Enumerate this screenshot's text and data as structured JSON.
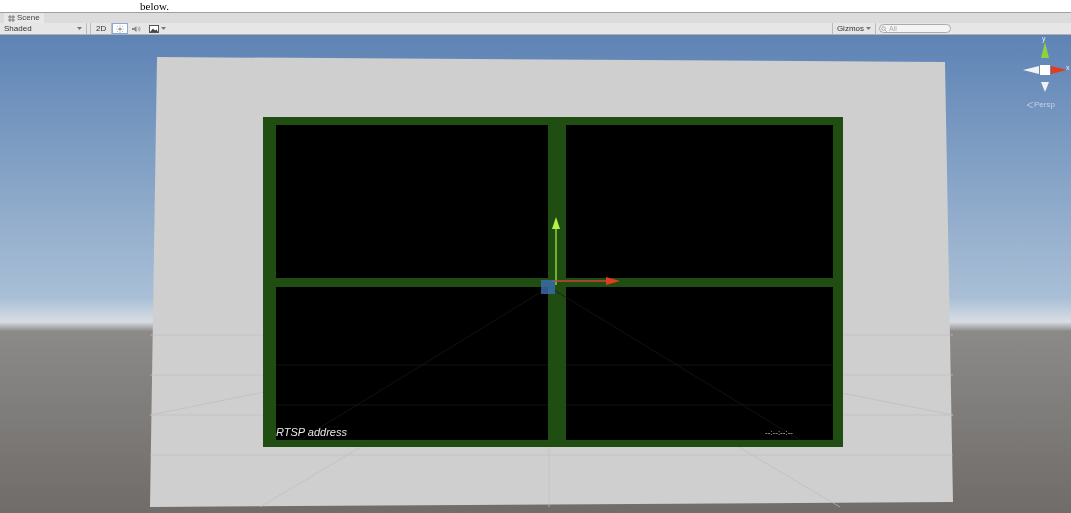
{
  "caption_fragment": "below.",
  "tabs": [
    {
      "label": "Scene",
      "selected": true
    }
  ],
  "toolbar": {
    "shading": "Shaded",
    "toggles": [
      {
        "kind": "text",
        "label": "2D",
        "selected": false
      },
      {
        "kind": "lighting",
        "selected": true
      },
      {
        "kind": "audio",
        "selected": false
      },
      {
        "kind": "effects",
        "selected": false
      }
    ],
    "gizmos": "Gizmos",
    "search": {
      "placeholder": "All"
    }
  },
  "scene": {
    "axis_labels": [
      "y",
      "x"
    ],
    "projection": "Persp",
    "address_label": "RTSP address",
    "timecode": "--:--:--:--"
  }
}
